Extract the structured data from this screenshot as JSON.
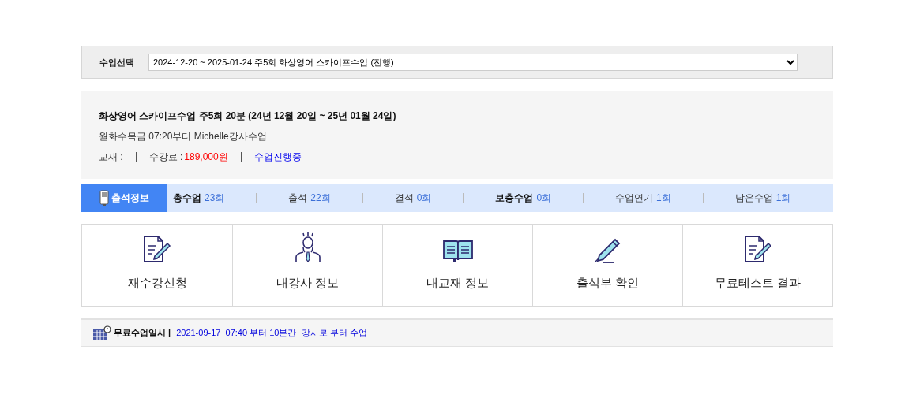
{
  "class_select": {
    "label": "수업선택",
    "value": "2024-12-20 ~ 2025-01-24 주5회 화상영어 스카이프수업 (진행)"
  },
  "course": {
    "title": "화상영어 스카이프수업 주5회 20분 (24년 12월 20일 ~ 25년 01월 24일)",
    "schedule": "월화수목금 07:20부터 Michelle강사수업",
    "textbook_label": "교재 :",
    "fee_label": "수강료 :",
    "fee": "189,000원",
    "status": "수업진행중"
  },
  "attendance": {
    "tab": "출석정보",
    "stats": [
      {
        "label": "총수업",
        "value": "23회",
        "bold": true
      },
      {
        "label": "출석",
        "value": "22회",
        "bold": false
      },
      {
        "label": "결석",
        "value": "0회",
        "bold": false
      },
      {
        "label": "보충수업",
        "value": "0회",
        "bold": true
      },
      {
        "label": "수업연기",
        "value": "1회",
        "bold": false
      },
      {
        "label": "남은수업",
        "value": "1회",
        "bold": false
      }
    ]
  },
  "menu": [
    {
      "kind": "document",
      "label": "재수강신청"
    },
    {
      "kind": "person",
      "label": "내강사 정보"
    },
    {
      "kind": "book",
      "label": "내교재 정보"
    },
    {
      "kind": "pencil",
      "label": "출석부 확인"
    },
    {
      "kind": "document",
      "label": "무료테스트 결과"
    }
  ],
  "free_class": {
    "label": "무료수업일시 |",
    "text": "2021-09-17  07:40 부터 10분간  강사로 부터 수업"
  }
}
